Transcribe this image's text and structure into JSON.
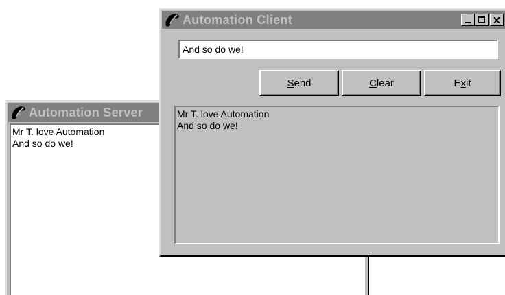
{
  "server": {
    "title": "Automation Server",
    "icon": "automation-app-icon",
    "log_lines": [
      "Mr T.  love Automation",
      "And so do we!"
    ]
  },
  "client": {
    "title": "Automation Client",
    "icon": "automation-app-icon",
    "message_input_value": "And so do we!",
    "buttons": {
      "send": {
        "prefix": "",
        "accel": "S",
        "rest": "end"
      },
      "clear": {
        "prefix": "",
        "accel": "C",
        "rest": "lear"
      },
      "exit": {
        "prefix": "E",
        "accel": "x",
        "rest": "it"
      }
    },
    "window_controls": [
      "minimize-icon",
      "maximize-icon",
      "close-icon"
    ],
    "log_lines": [
      "Mr T.  love Automation",
      "And so do we!"
    ]
  },
  "colors": {
    "title_inactive_bg": "#808080",
    "title_inactive_text": "#c0c0c0",
    "face": "#c0c0c0"
  }
}
